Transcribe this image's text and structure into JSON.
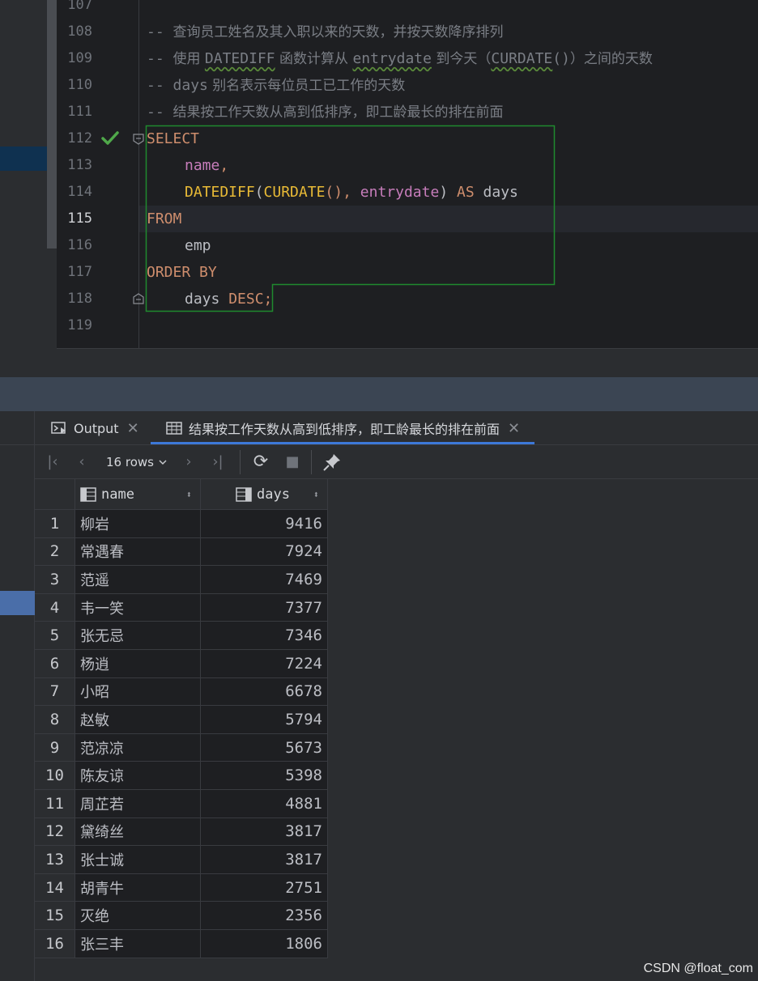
{
  "editor": {
    "lines": [
      {
        "num": "107"
      },
      {
        "num": "108",
        "comment_prefix": "-- ",
        "comment_text": "查询员工姓名及其入职以来的天数，并按天数降序排列"
      },
      {
        "num": "109",
        "comment_prefix": "-- ",
        "c1": "使用 ",
        "c2": "DATEDIFF",
        "c3": " 函数计算从 ",
        "c4": "entrydate",
        "c5": " 到今天（",
        "c6": "CURDATE",
        "c7": "()",
        "c8": "）之间的天数"
      },
      {
        "num": "110",
        "comment_prefix": "-- ",
        "c1": "days",
        "c2": " 别名表示每位员工已工作的天数"
      },
      {
        "num": "111",
        "comment_prefix": "-- ",
        "comment_text": "结果按工作天数从高到低排序，即工龄最长的排在前面"
      },
      {
        "num": "112",
        "kw": "SELECT"
      },
      {
        "num": "113",
        "col": "name",
        "punct": ","
      },
      {
        "num": "114",
        "fn1": "DATEDIFF",
        "p1": "(",
        "fn2": "CURDATE",
        "p2": "(), ",
        "col": "entrydate",
        "p3": ") ",
        "kw": "AS",
        "alias": " days"
      },
      {
        "num": "115",
        "kw": "FROM"
      },
      {
        "num": "116",
        "table": "emp"
      },
      {
        "num": "117",
        "kw": "ORDER BY"
      },
      {
        "num": "118",
        "col": "days",
        "kw": " DESC",
        "punct": ";"
      },
      {
        "num": "119"
      }
    ]
  },
  "tabs": {
    "output_label": "Output",
    "result_label": "结果按工作天数从高到低排序，即工龄最长的排在前面",
    "close_glyph": "✕"
  },
  "toolbar": {
    "rows_label": "16 rows",
    "first_glyph": "|‹",
    "prev_glyph": "‹",
    "next_glyph": "›",
    "last_glyph": "›|",
    "refresh_glyph": "⟳",
    "stop_glyph": "■",
    "pin_glyph": "📌"
  },
  "grid": {
    "col_name": "name",
    "col_days": "days",
    "sort_glyph": "⬍",
    "rows": [
      {
        "idx": "1",
        "name": "柳岩",
        "days": "9416"
      },
      {
        "idx": "2",
        "name": "常遇春",
        "days": "7924"
      },
      {
        "idx": "3",
        "name": "范遥",
        "days": "7469"
      },
      {
        "idx": "4",
        "name": "韦一笑",
        "days": "7377"
      },
      {
        "idx": "5",
        "name": "张无忌",
        "days": "7346"
      },
      {
        "idx": "6",
        "name": "杨逍",
        "days": "7224"
      },
      {
        "idx": "7",
        "name": "小昭",
        "days": "6678"
      },
      {
        "idx": "8",
        "name": "赵敏",
        "days": "5794"
      },
      {
        "idx": "9",
        "name": "范凉凉",
        "days": "5673"
      },
      {
        "idx": "10",
        "name": "陈友谅",
        "days": "5398"
      },
      {
        "idx": "11",
        "name": "周芷若",
        "days": "4881"
      },
      {
        "idx": "12",
        "name": "黛绮丝",
        "days": "3817"
      },
      {
        "idx": "13",
        "name": "张士诚",
        "days": "3817"
      },
      {
        "idx": "14",
        "name": "胡青牛",
        "days": "2751"
      },
      {
        "idx": "15",
        "name": "灭绝",
        "days": "2356"
      },
      {
        "idx": "16",
        "name": "张三丰",
        "days": "1806"
      }
    ]
  },
  "watermark": "CSDN @float_com",
  "colors": {
    "keyword": "#cf8e6d",
    "function": "#e8ba36",
    "column": "#c77dbb",
    "comment": "#7a7e85",
    "selection_box": "#1f8a2e",
    "tab_underline": "#3d78d8"
  }
}
